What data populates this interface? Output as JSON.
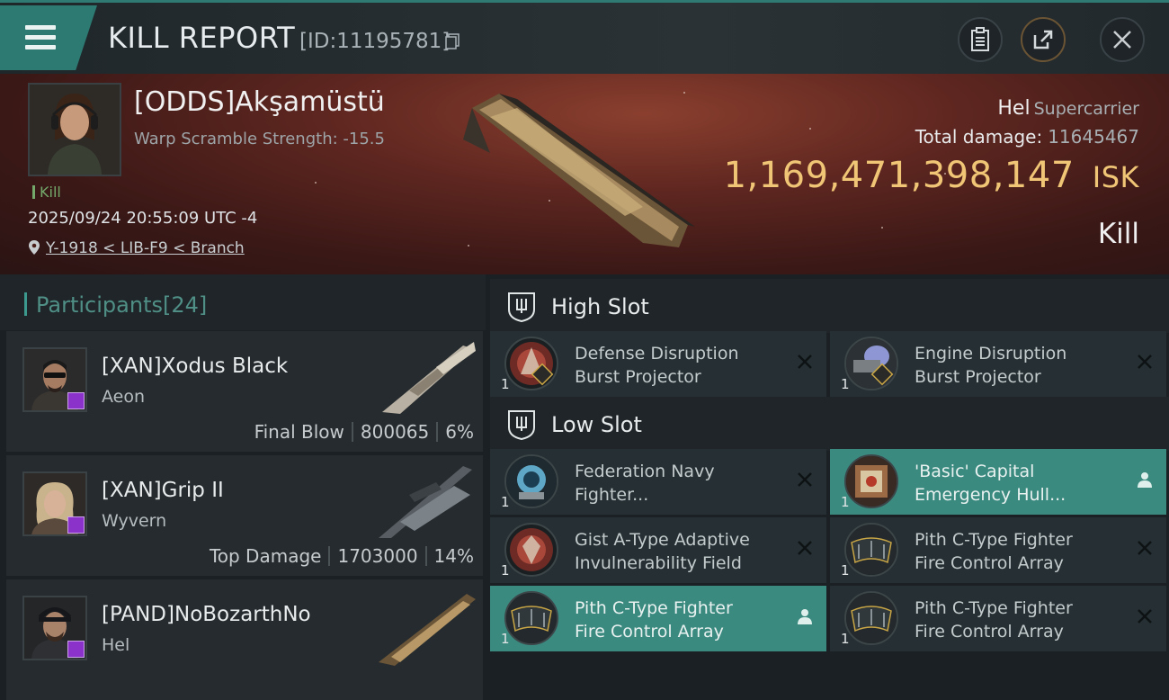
{
  "header": {
    "title": "KILL REPORT",
    "kill_id": "[ID:11195781]"
  },
  "victim": {
    "name": "[ODDS]Akşamüstü",
    "scramble": "Warp Scramble Strength: -15.5",
    "kill_tag": "Kill",
    "datetime": "2025/09/24 20:55:09 UTC -4",
    "location": "Y-1918 < LIB-F9 < Branch",
    "ship_name": "Hel",
    "ship_class": "Supercarrier",
    "total_damage_label": "Total damage:",
    "total_damage": "11645467",
    "isk_value": "1,169,471,398,147",
    "isk_unit": "ISK",
    "result": "Kill"
  },
  "participants": {
    "title": "Participants",
    "count": "[24]",
    "items": [
      {
        "name": "[XAN]Xodus Black",
        "ship": "Aeon",
        "role": "Final Blow",
        "damage": "800065",
        "percent": "6%"
      },
      {
        "name": "[XAN]Grip II",
        "ship": "Wyvern",
        "role": "Top Damage",
        "damage": "1703000",
        "percent": "14%"
      },
      {
        "name": "[PAND]NoBozarthNo",
        "ship": "Hel",
        "role": "",
        "damage": "",
        "percent": ""
      }
    ]
  },
  "high_slot": {
    "label": "High Slot",
    "modules": [
      {
        "line1": "Defense Disruption",
        "line2": "Burst Projector",
        "qty": "1"
      },
      {
        "line1": "Engine Disruption",
        "line2": "Burst Projector",
        "qty": "1"
      }
    ]
  },
  "low_slot": {
    "label": "Low Slot",
    "modules": [
      {
        "line1": "Federation Navy",
        "line2": "Fighter...",
        "qty": "1"
      },
      {
        "line1": "'Basic' Capital",
        "line2": "Emergency Hull...",
        "qty": "1"
      },
      {
        "line1": "Gist A-Type Adaptive",
        "line2": "Invulnerability Field",
        "qty": "1"
      },
      {
        "line1": "Pith C-Type Fighter",
        "line2": "Fire Control Array",
        "qty": "1"
      },
      {
        "line1": "Pith C-Type Fighter",
        "line2": "Fire Control Array",
        "qty": "1"
      },
      {
        "line1": "Pith C-Type Fighter",
        "line2": "Fire Control Array",
        "qty": "1"
      }
    ]
  },
  "icons": {
    "menu": "hamburger-icon",
    "copy": "copy-icon",
    "clipboard": "clipboard-icon",
    "share": "share-icon",
    "close": "close-icon",
    "location": "location-pin-icon",
    "slot": "shield-slot-icon",
    "dropped": "close-x-icon",
    "pilot": "pilot-icon"
  },
  "colors": {
    "accent": "#2c7a72",
    "isk": "#f0c676",
    "highlight": "#3b8a80",
    "badge": "#8a32c9"
  }
}
